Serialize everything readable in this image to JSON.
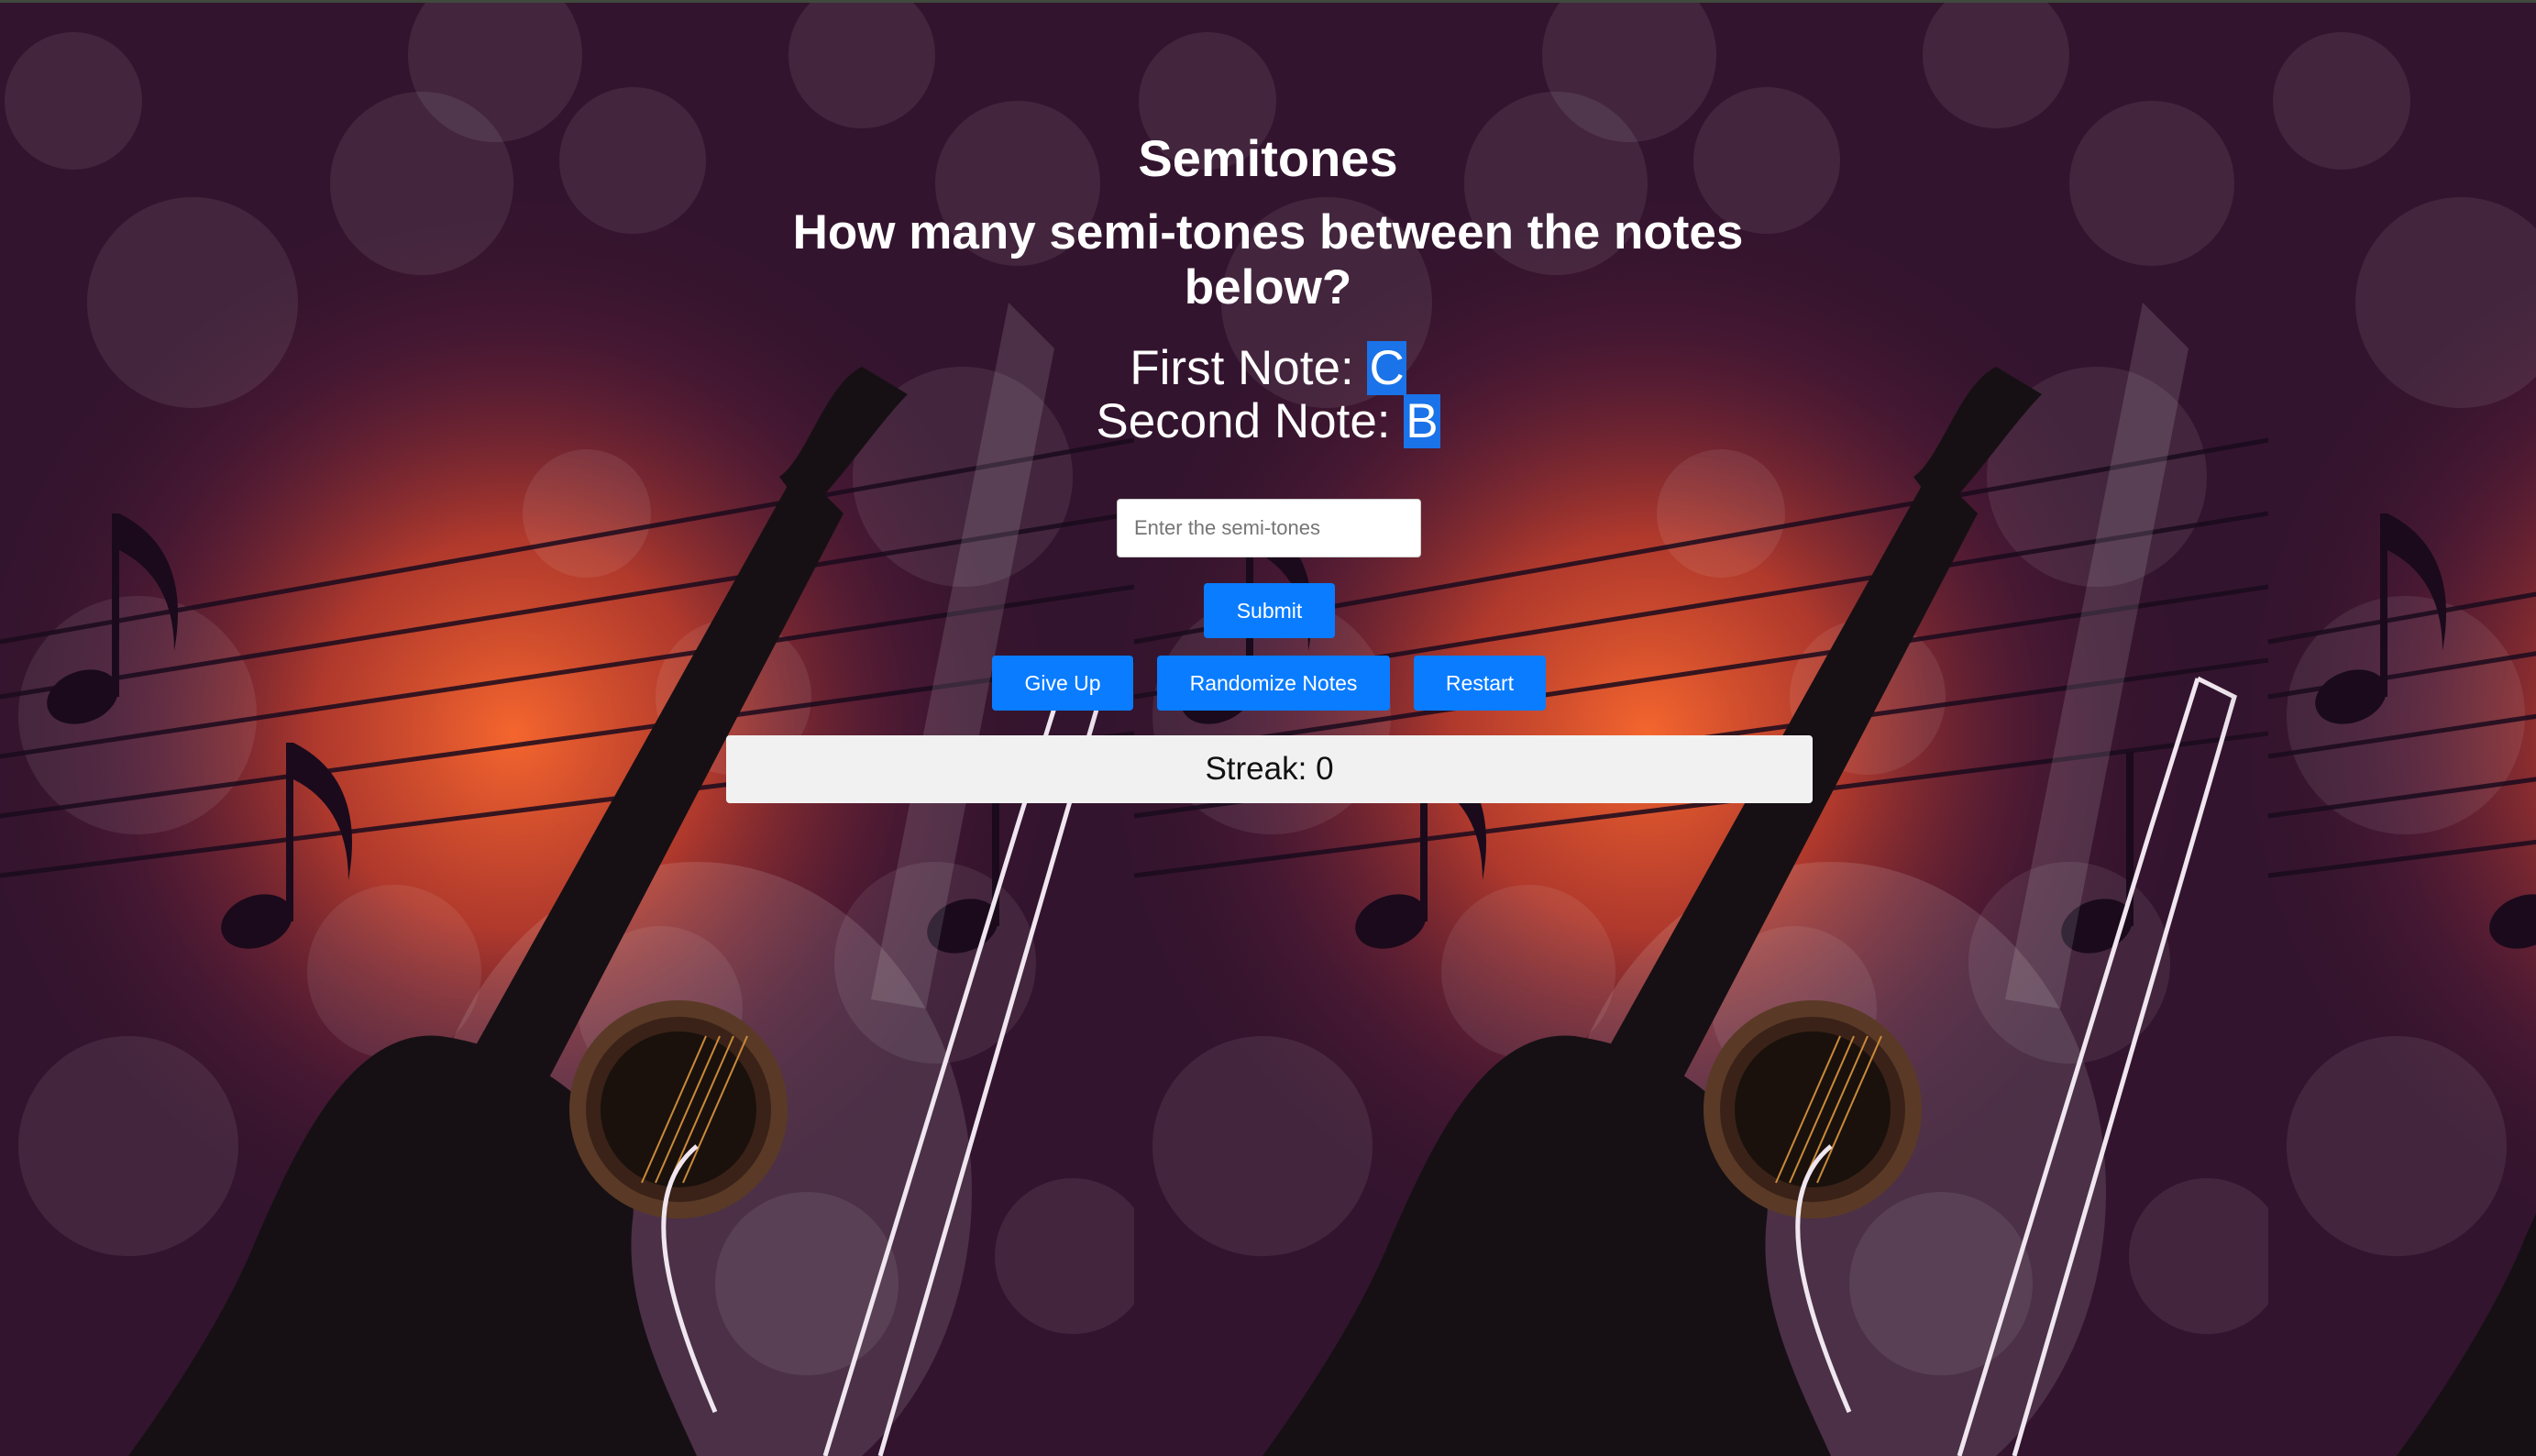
{
  "page": {
    "title": "Semitones",
    "question": "How many semi-tones between the notes below?"
  },
  "notes": {
    "first_label": "First Note:",
    "first_value": "C",
    "second_label": "Second Note:",
    "second_value": "B"
  },
  "answer": {
    "placeholder": "Enter the semi-tones",
    "value": ""
  },
  "buttons": {
    "submit": "Submit",
    "give_up": "Give Up",
    "randomize": "Randomize Notes",
    "restart": "Restart"
  },
  "streak": {
    "label": "Streak:",
    "value": "0"
  },
  "colors": {
    "accent": "#0a7cff",
    "highlight": "#1a73e8",
    "background": "#2a1024",
    "glow": "#e0562a",
    "streak_bg": "#f1f1f1"
  },
  "icons": [
    "guitar-icon",
    "music-note-icon",
    "bokeh-circle"
  ]
}
